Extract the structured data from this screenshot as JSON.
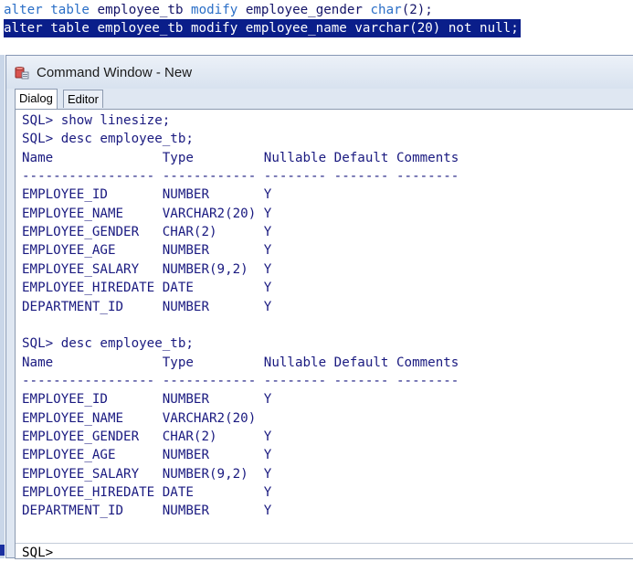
{
  "editor": {
    "line1": {
      "kw1": "alter",
      "kw2": "table",
      "table": "employee_tb",
      "kw3": "modify",
      "col": "employee_gender",
      "kw4": "char",
      "rest": "(2);"
    },
    "line2": {
      "text": "alter table employee_tb modify employee_name varchar(20) not null;"
    }
  },
  "window": {
    "title": "Command Window - New",
    "icon": "database-icon",
    "tabs": [
      {
        "label": "Dialog",
        "active": true
      },
      {
        "label": "Editor",
        "active": false
      }
    ]
  },
  "console": {
    "lines": [
      "SQL> show linesize;",
      "SQL> desc employee_tb;",
      "Name              Type         Nullable Default Comments",
      "----------------- ------------ -------- ------- --------",
      "EMPLOYEE_ID       NUMBER       Y",
      "EMPLOYEE_NAME     VARCHAR2(20) Y",
      "EMPLOYEE_GENDER   CHAR(2)      Y",
      "EMPLOYEE_AGE      NUMBER       Y",
      "EMPLOYEE_SALARY   NUMBER(9,2)  Y",
      "EMPLOYEE_HIREDATE DATE         Y",
      "DEPARTMENT_ID     NUMBER       Y",
      "",
      "SQL> desc employee_tb;",
      "Name              Type         Nullable Default Comments",
      "----------------- ------------ -------- ------- --------",
      "EMPLOYEE_ID       NUMBER       Y",
      "EMPLOYEE_NAME     VARCHAR2(20)",
      "EMPLOYEE_GENDER   CHAR(2)      Y",
      "EMPLOYEE_AGE      NUMBER       Y",
      "EMPLOYEE_SALARY   NUMBER(9,2)  Y",
      "EMPLOYEE_HIREDATE DATE         Y",
      "DEPARTMENT_ID     NUMBER       Y"
    ],
    "prompt": "SQL>"
  },
  "colors": {
    "code_text": "#1a1a80",
    "keyword": "#2b6fc7",
    "selection": "#0a1e8a"
  }
}
